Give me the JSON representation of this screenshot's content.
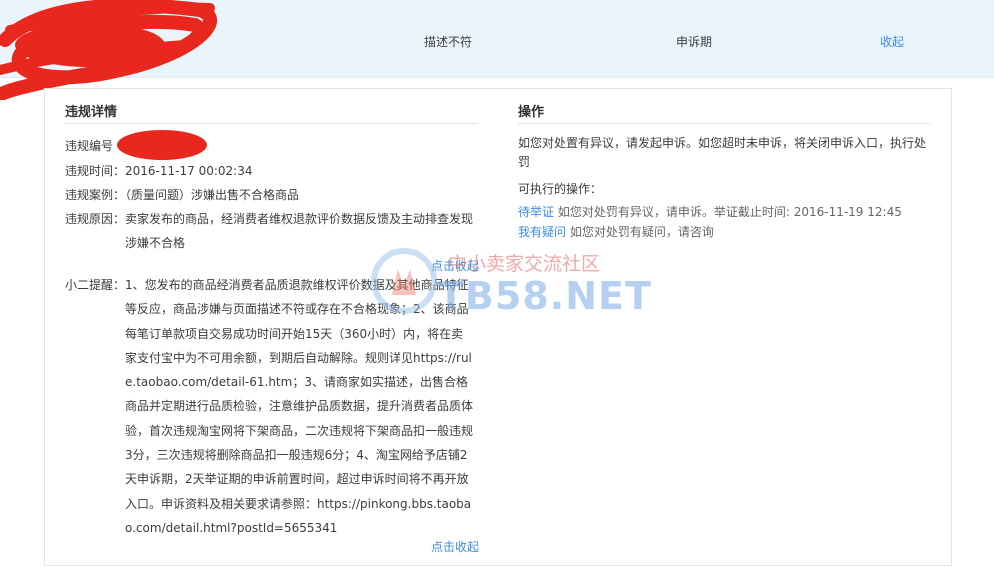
{
  "top_row": {
    "reason": "描述不符",
    "status": "申诉期",
    "collapse_link": "收起"
  },
  "details": {
    "title": "违规详情",
    "id_label": "违规编号",
    "time_label": "违规时间：",
    "time_value": "2016-11-17 00:02:34",
    "case_label": "违规案例：",
    "case_value": "（质量问题）涉嫌出售不合格商品",
    "reason_label": "违规原因：",
    "reason_value": "卖家发布的商品，经消费者维权退款评价数据反馈及主动排查发现涉嫌不合格",
    "collapse_link_1": "点击收起",
    "reminder_label": "小二提醒：",
    "reminder_value": "1、您发布的商品经消费者品质退款维权评价数据及其他商品特征等反应，商品涉嫌与页面描述不符或存在不合格现象；2、该商品每笔订单款项自交易成功时间开始15天（360小时）内，将在卖家支付宝中为不可用余额，到期后自动解除。规则详见https://rule.taobao.com/detail-61.htm；3、请商家如实描述，出售合格商品并定期进行品质检验，注意维护品质数据，提升消费者品质体验，首次违规淘宝网将下架商品，二次违规将下架商品扣一般违规3分，三次违规将删除商品扣一般违规6分；4、淘宝网给予店铺2天申诉期，2天举证期的申诉前置时间，超过申诉时间将不再开放入口。申诉资料及相关要求请参照：https://pinkong.bbs.taobao.com/detail.html?postId=5655341",
    "collapse_link_2": "点击收起"
  },
  "operations": {
    "title": "操作",
    "notice": "如您对处置有异议，请发起申诉。如您超时未申诉，将关闭申诉入口，执行处罚",
    "available_label": "可执行的操作：",
    "action1_link": "待举证",
    "action1_desc": "如您对处罚有异议，请申诉。举证截止时间: 2016-11-19 12:45",
    "action2_link": "我有疑问",
    "action2_desc": "如您对处罚有疑问，请咨询"
  },
  "watermark": {
    "line1": "中小卖家交流社区",
    "line2": "TB58.NET"
  },
  "colors": {
    "link": "#3a8ee6",
    "top_row_bg": "#eaf4fb",
    "redaction": "#e8281e"
  }
}
